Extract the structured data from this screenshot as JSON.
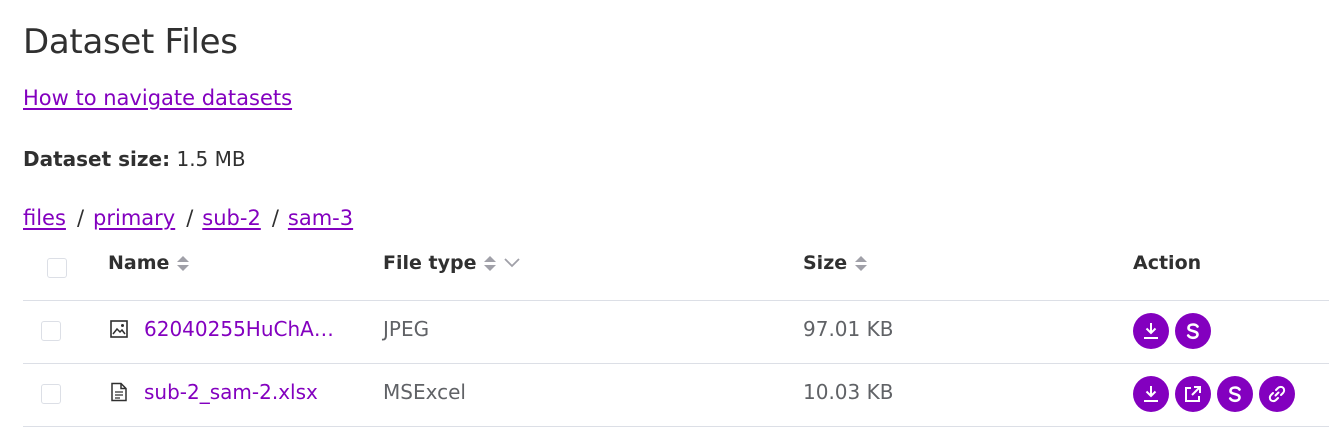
{
  "page": {
    "title": "Dataset Files",
    "help_link": "How to navigate datasets",
    "size_label": "Dataset size:",
    "size_value": "1.5 MB"
  },
  "breadcrumbs": [
    "files",
    "primary",
    "sub-2",
    "sam-3"
  ],
  "breadcrumb_separator": "/",
  "table": {
    "columns": {
      "name": "Name",
      "file_type": "File type",
      "size": "Size",
      "action": "Action"
    },
    "rows": [
      {
        "icon": "image-file-icon",
        "name": "62040255HuChA…",
        "file_type": "JPEG",
        "size": "97.01 KB",
        "actions": [
          "download-icon",
          "sparc-icon"
        ]
      },
      {
        "icon": "document-file-icon",
        "name": "sub-2_sam-2.xlsx",
        "file_type": "MSExcel",
        "size": "10.03 KB",
        "actions": [
          "download-icon",
          "open-external-icon",
          "sparc-icon",
          "copy-link-icon"
        ]
      }
    ]
  },
  "colors": {
    "accent": "#8300bf",
    "text": "#303030",
    "muted_text": "#606266",
    "border": "#dcdfe6"
  }
}
